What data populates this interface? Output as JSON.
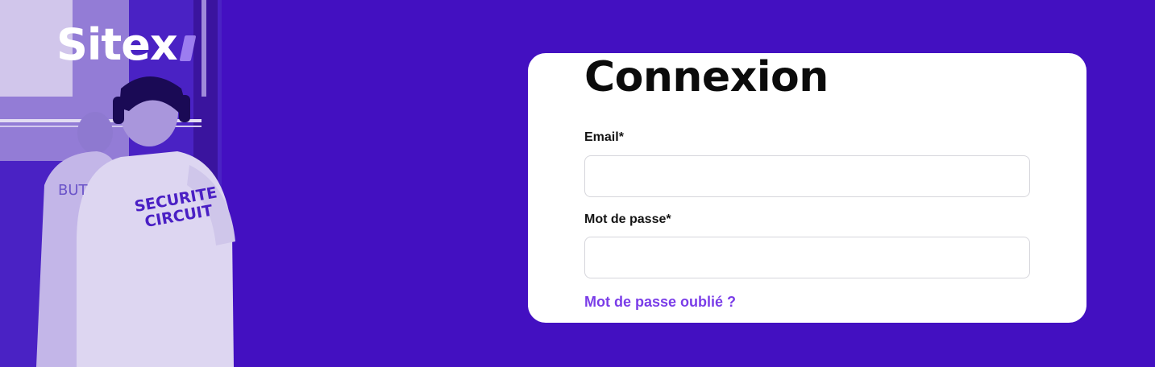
{
  "brand": {
    "name": "Sitex"
  },
  "hero": {
    "shirt_back_text": "SECURITE CIRCUIT",
    "shirt_side_text": "BUT"
  },
  "login": {
    "title": "Connexion",
    "email_label": "Email*",
    "email_value": "",
    "password_label": "Mot de passe*",
    "password_value": "",
    "forgot_link": "Mot de passe oublié ?"
  },
  "colors": {
    "background": "#4310c1",
    "link": "#7a3de8",
    "card": "#ffffff"
  }
}
